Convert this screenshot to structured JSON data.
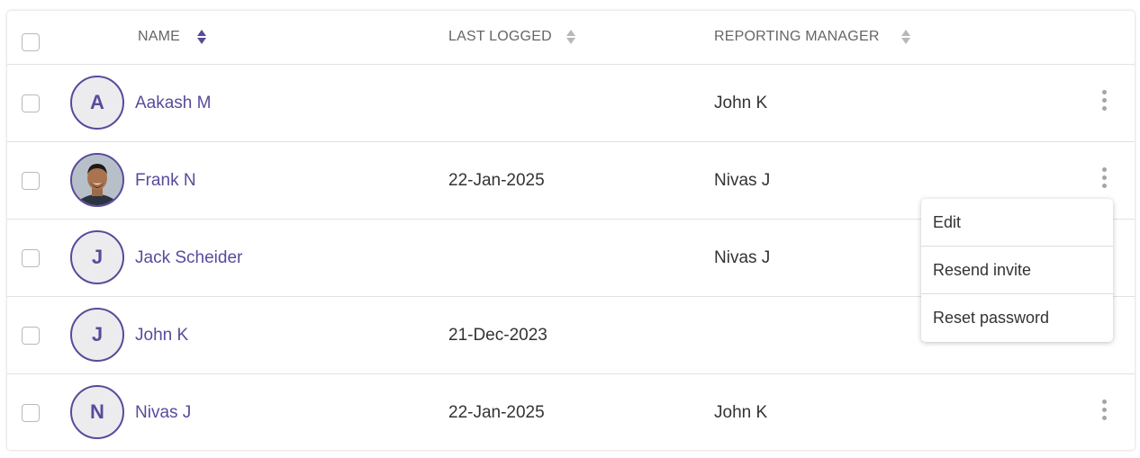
{
  "table": {
    "columns": {
      "name": "NAME",
      "last_logged": "LAST LOGGED",
      "reporting_manager": "REPORTING MANAGER"
    },
    "sort": {
      "name": "ascending",
      "last_logged": "none",
      "reporting_manager": "none"
    },
    "rows": [
      {
        "initial": "A",
        "name": "Aakash M",
        "last_logged": "",
        "manager": "John K",
        "has_photo": false
      },
      {
        "initial": "",
        "name": "Frank N",
        "last_logged": "22-Jan-2025",
        "manager": "Nivas J",
        "has_photo": true
      },
      {
        "initial": "J",
        "name": "Jack Scheider",
        "last_logged": "",
        "manager": "Nivas J",
        "has_photo": false
      },
      {
        "initial": "J",
        "name": "John K",
        "last_logged": "21-Dec-2023",
        "manager": "",
        "has_photo": false
      },
      {
        "initial": "N",
        "name": "Nivas J",
        "last_logged": "22-Jan-2025",
        "manager": "John K",
        "has_photo": false
      }
    ]
  },
  "context_menu": {
    "items": [
      "Edit",
      "Resend invite",
      "Reset password"
    ]
  },
  "colors": {
    "accent": "#5a4a9b",
    "sort_inactive": "#b8b8b8"
  }
}
